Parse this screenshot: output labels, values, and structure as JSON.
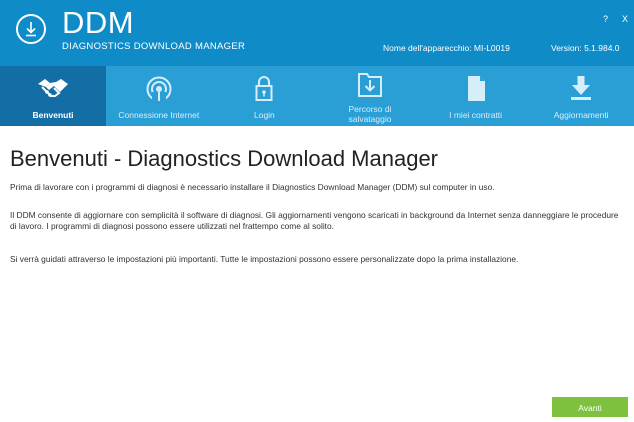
{
  "header": {
    "title": "DDM",
    "subtitle": "DIAGNOSTICS DOWNLOAD MANAGER",
    "device_label": "Nome dell'apparecchio: MI-L0019",
    "version_label": "Version: 5.1.984.0",
    "help": "?",
    "close": "X"
  },
  "nav": {
    "items": [
      {
        "label": "Benvenuti",
        "icon": "handshake-icon",
        "active": true
      },
      {
        "label": "Connessione Internet",
        "icon": "wireless-signal-icon",
        "active": false
      },
      {
        "label": "Login",
        "icon": "lock-icon",
        "active": false
      },
      {
        "label": "Percorso di salvataggio",
        "line1": "Percorso di",
        "line2": "salvataggio",
        "icon": "folder-download-icon",
        "active": false
      },
      {
        "label": "I miei contratti",
        "icon": "document-icon",
        "active": false
      },
      {
        "label": "Aggiornamenti",
        "icon": "download-arrow-icon",
        "active": false
      }
    ]
  },
  "main": {
    "title": "Benvenuti - Diagnostics Download Manager",
    "paragraphs": [
      "Prima di lavorare con i programmi di diagnosi è necessario installare il Diagnostics Download Manager (DDM) sul computer in uso.",
      "Il DDM consente di aggiornare con semplicità il software di diagnosi. Gli aggiornamenti vengono scaricati in background da Internet senza danneggiare le procedure di lavoro. I programmi di diagnosi possono essere utilizzati nel frattempo come al solito.",
      "Si verrà guidati attraverso le impostazioni più importanti. Tutte le impostazioni possono essere personalizzate dopo la prima installazione."
    ],
    "next_button": "Avanti"
  },
  "colors": {
    "header_bg": "#0f8bc8",
    "nav_bg": "#2a9fd6",
    "nav_active_bg": "#136ea6",
    "button_green": "#7ec13e"
  }
}
